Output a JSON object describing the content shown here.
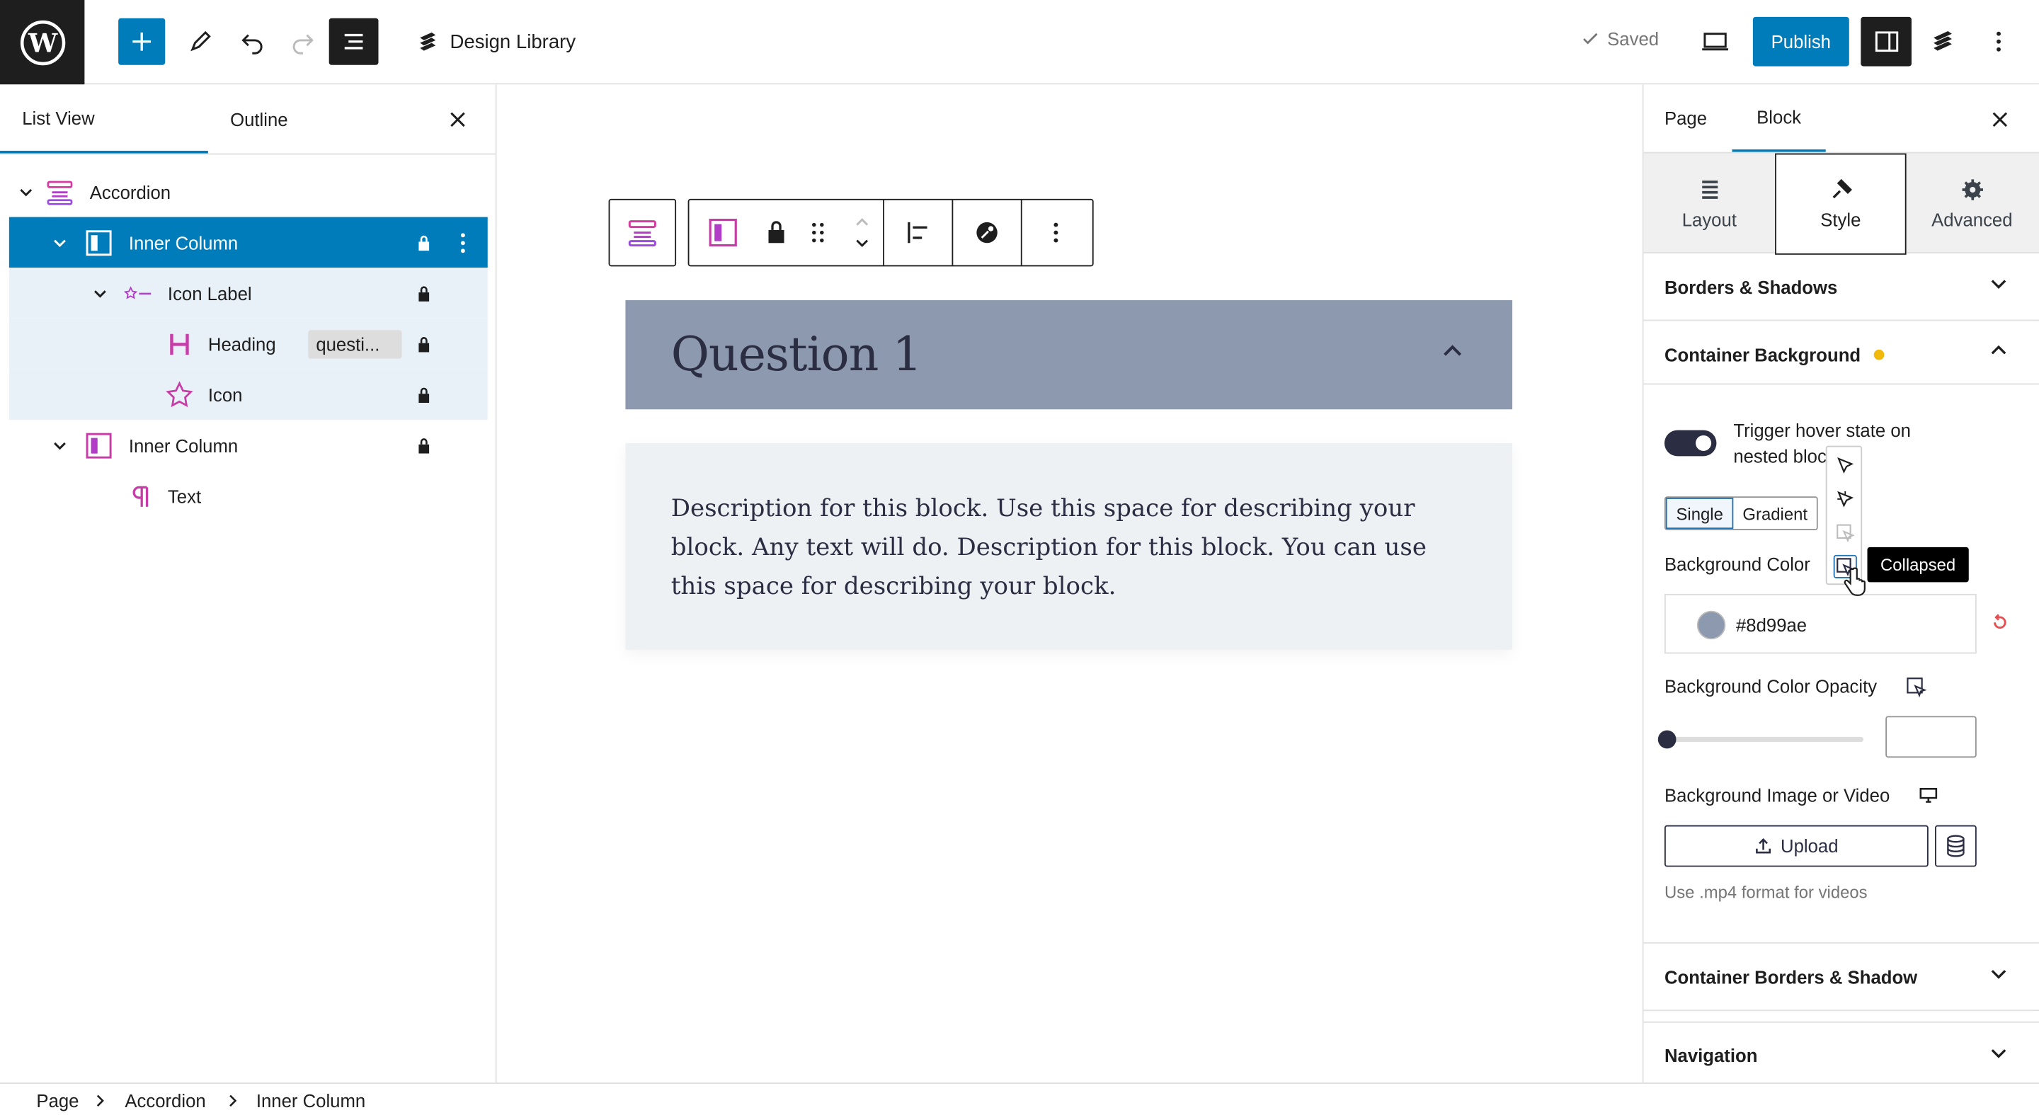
{
  "topbar": {
    "doc_title": "Design Library",
    "saved_label": "Saved",
    "publish_label": "Publish"
  },
  "left_panel": {
    "tabs": [
      "List View",
      "Outline"
    ],
    "tree": [
      {
        "label": "Accordion",
        "depth": 0,
        "icon": "accordion-icon"
      },
      {
        "label": "Inner Column",
        "depth": 1,
        "icon": "column-icon",
        "selected": true
      },
      {
        "label": "Icon Label",
        "depth": 2,
        "icon": "icon-label-icon"
      },
      {
        "label": "Heading",
        "depth": 3,
        "icon": "heading-icon",
        "badge": "questi..."
      },
      {
        "label": "Icon",
        "depth": 3,
        "icon": "star-icon"
      },
      {
        "label": "Inner Column",
        "depth": 1,
        "icon": "column-icon"
      },
      {
        "label": "Text",
        "depth": 2,
        "icon": "paragraph-icon"
      }
    ]
  },
  "canvas": {
    "question_title": "Question 1",
    "description": "Description for this block. Use this space for describing your block. Any text will do. Description for this block. You can use this space for describing your block.",
    "question_bg": "#8d99ae",
    "description_bg": "#edf1f4"
  },
  "right_panel": {
    "tabs": [
      "Page",
      "Block"
    ],
    "sub_tabs": [
      "Layout",
      "Style",
      "Advanced"
    ],
    "sections": {
      "borders_shadows": "Borders & Shadows",
      "container_background": "Container Background",
      "container_borders": "Container Borders & Shadow",
      "navigation": "Navigation"
    },
    "toggle_label": "Trigger hover state on nested blocks",
    "toggle_label_visible": "Trigger hover state on nested bloc",
    "segments": [
      "Single",
      "Gradient"
    ],
    "bg_color_label": "Background Color",
    "bg_color_value": "#8d99ae",
    "opacity_label": "Background Color Opacity",
    "bg_media_label": "Background Image or Video",
    "upload_label": "Upload",
    "upload_help": "Use .mp4 format for videos",
    "tooltip": "Collapsed",
    "accent_dot": "#f0b90b"
  },
  "breadcrumb": [
    "Page",
    "Accordion",
    "Inner Column"
  ]
}
